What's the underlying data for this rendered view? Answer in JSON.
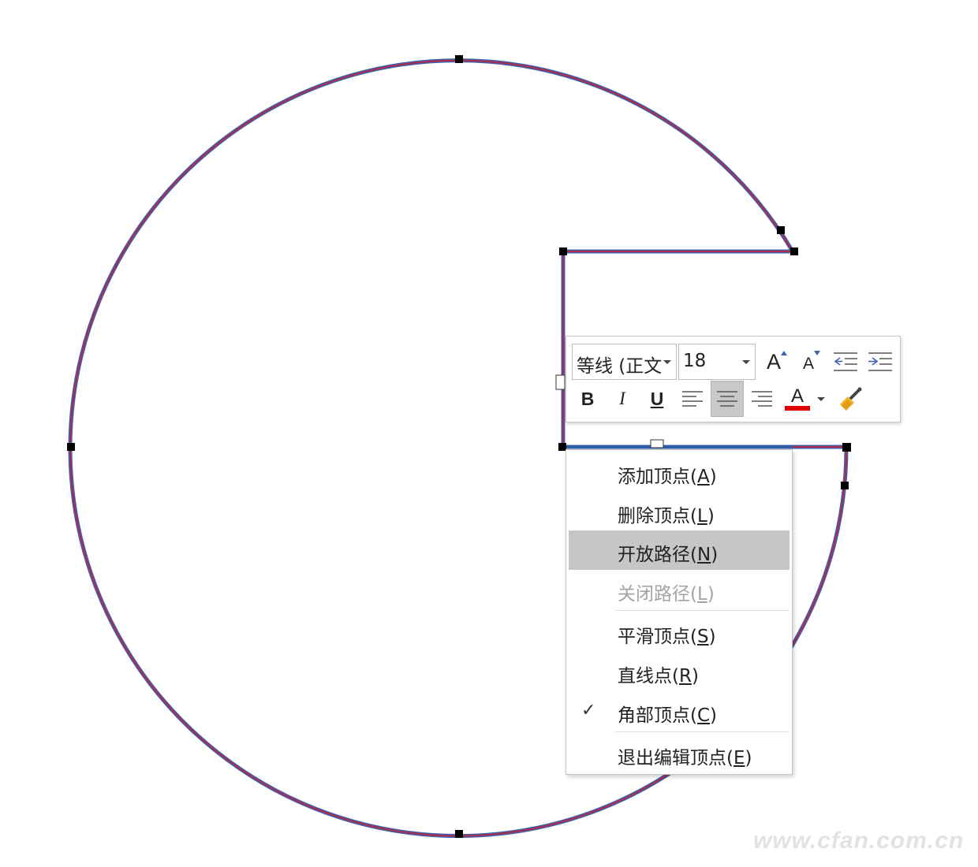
{
  "mini_toolbar": {
    "font_name": "等线 (正文",
    "font_size": "18",
    "buttons": {
      "increase_font": "A",
      "decrease_font": "A",
      "bold": "B",
      "italic": "I",
      "underline": "U",
      "font_color": "A"
    },
    "font_color_value": "#e00000"
  },
  "context_menu": {
    "items": [
      {
        "label": "添加顶点(",
        "key": "A",
        "end": ")",
        "state": "normal"
      },
      {
        "label": "删除顶点(",
        "key": "L",
        "end": ")",
        "state": "normal"
      },
      {
        "label": "开放路径(",
        "key": "N",
        "end": ")",
        "state": "highlighted"
      },
      {
        "label": "关闭路径(",
        "key": "L",
        "end": ")",
        "state": "disabled"
      },
      {
        "label": "平滑顶点(",
        "key": "S",
        "end": ")",
        "state": "normal"
      },
      {
        "label": "直线点(",
        "key": "R",
        "end": ")",
        "state": "normal"
      },
      {
        "label": "角部顶点(",
        "key": "C",
        "end": ")",
        "state": "checked",
        "check": "✓"
      },
      {
        "label": "退出编辑顶点(",
        "key": "E",
        "end": ")",
        "state": "normal"
      }
    ]
  },
  "watermark": "www.cfan.com.cn",
  "colors": {
    "shape_outer": "#3f5fa8",
    "shape_inner": "#b02a4a",
    "edit_path": "#2e5ea6",
    "highlight": "#c6c6c6"
  }
}
